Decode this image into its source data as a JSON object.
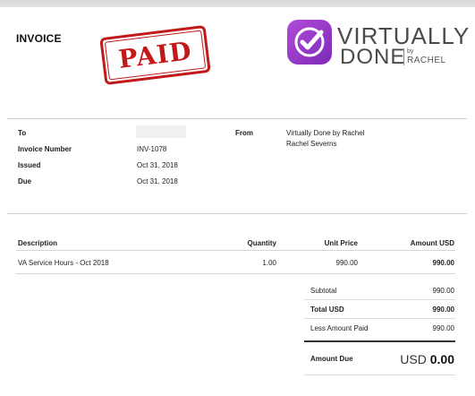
{
  "header": {
    "title": "INVOICE",
    "stamp": "PAID",
    "logo": {
      "line1": "VIRTUALLY",
      "line2": "DONE",
      "by": "by",
      "rachel": "RACHEL"
    }
  },
  "details": {
    "to_label": "To",
    "number_label": "Invoice Number",
    "number_value": "INV-1078",
    "issued_label": "Issued",
    "issued_value": "Oct 31, 2018",
    "due_label": "Due",
    "due_value": "Oct 31, 2018",
    "from_label": "From",
    "from_line1": "Virtually Done by Rachel",
    "from_line2": "Rachel Severns"
  },
  "items": {
    "headers": {
      "description": "Description",
      "quantity": "Quantity",
      "unit_price": "Unit Price",
      "amount": "Amount USD"
    },
    "rows": [
      {
        "description": "VA Service Hours - Oct 2018",
        "quantity": "1.00",
        "unit_price": "990.00",
        "amount": "990.00"
      }
    ]
  },
  "totals": {
    "subtotal_label": "Subtotal",
    "subtotal_value": "990.00",
    "total_label": "Total USD",
    "total_value": "990.00",
    "paid_label": "Less Amount Paid",
    "paid_value": "990.00",
    "due_label": "Amount Due",
    "due_currency": "USD",
    "due_value": "0.00"
  },
  "colors": {
    "stamp": "#c21a1a",
    "logo_gradient_start": "#b24bd8",
    "logo_gradient_end": "#7c2bb8"
  }
}
